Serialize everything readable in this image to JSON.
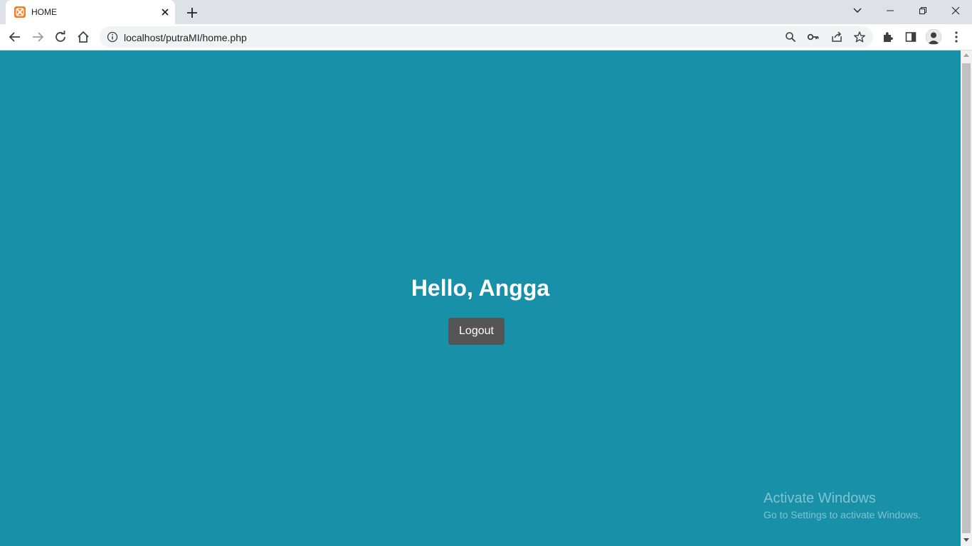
{
  "browser": {
    "tab": {
      "title": "HOME",
      "favicon": "xampp-icon"
    },
    "address": {
      "url": "localhost/putraMI/home.php"
    },
    "colors": {
      "tabstrip": "#dee1e6",
      "toolbar": "#ffffff"
    }
  },
  "page": {
    "greeting": "Hello, Angga",
    "logout_label": "Logout",
    "background_color": "#1790a8",
    "button_color": "#555555"
  },
  "watermark": {
    "title": "Activate Windows",
    "subtitle": "Go to Settings to activate Windows."
  }
}
